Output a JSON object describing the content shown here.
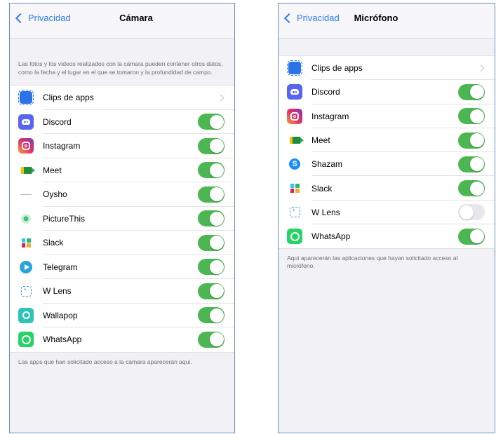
{
  "camera": {
    "back_label": "Privacidad",
    "title": "Cámara",
    "description": "Las fotos y los vídeos realizados con la cámara pueden contener otros datos, como la fecha y el lugar en el que se tomaron y la profundidad de campo.",
    "apps": [
      {
        "label": "Clips de apps",
        "icon": "clips-icon",
        "control": "chevron"
      },
      {
        "label": "Discord",
        "icon": "discord-icon",
        "control": "toggle",
        "enabled": true
      },
      {
        "label": "Instagram",
        "icon": "instagram-icon",
        "control": "toggle",
        "enabled": true
      },
      {
        "label": "Meet",
        "icon": "meet-icon",
        "control": "toggle",
        "enabled": true
      },
      {
        "label": "Oysho",
        "icon": "oysho-icon",
        "control": "toggle",
        "enabled": true
      },
      {
        "label": "PictureThis",
        "icon": "picturethis-icon",
        "control": "toggle",
        "enabled": true
      },
      {
        "label": "Slack",
        "icon": "slack-icon",
        "control": "toggle",
        "enabled": true
      },
      {
        "label": "Telegram",
        "icon": "telegram-icon",
        "control": "toggle",
        "enabled": true
      },
      {
        "label": "W Lens",
        "icon": "wlens-icon",
        "control": "toggle",
        "enabled": true
      },
      {
        "label": "Wallapop",
        "icon": "wallapop-icon",
        "control": "toggle",
        "enabled": true
      },
      {
        "label": "WhatsApp",
        "icon": "whatsapp-icon",
        "control": "toggle",
        "enabled": true
      }
    ],
    "footer": "Las apps que han solicitado acceso a la cámara aparecerán aquí."
  },
  "microphone": {
    "back_label": "Privacidad",
    "title": "Micrófono",
    "apps": [
      {
        "label": "Clips de apps",
        "icon": "clips-icon",
        "control": "chevron"
      },
      {
        "label": "Discord",
        "icon": "discord-icon",
        "control": "toggle",
        "enabled": true
      },
      {
        "label": "Instagram",
        "icon": "instagram-icon",
        "control": "toggle",
        "enabled": true
      },
      {
        "label": "Meet",
        "icon": "meet-icon",
        "control": "toggle",
        "enabled": true
      },
      {
        "label": "Shazam",
        "icon": "shazam-icon",
        "control": "toggle",
        "enabled": true
      },
      {
        "label": "Slack",
        "icon": "slack-icon",
        "control": "toggle",
        "enabled": true
      },
      {
        "label": "W Lens",
        "icon": "wlens-icon",
        "control": "toggle",
        "enabled": false
      },
      {
        "label": "WhatsApp",
        "icon": "whatsapp-icon",
        "control": "toggle",
        "enabled": true
      }
    ],
    "footer": "Aquí aparecerán las aplicaciones que hayan solicitado acceso al micrófono."
  },
  "colors": {
    "accent": "#2f7cf6",
    "toggle_on": "#4cb752",
    "toggle_off": "#e8e8ec",
    "background": "#f1f1f6"
  }
}
